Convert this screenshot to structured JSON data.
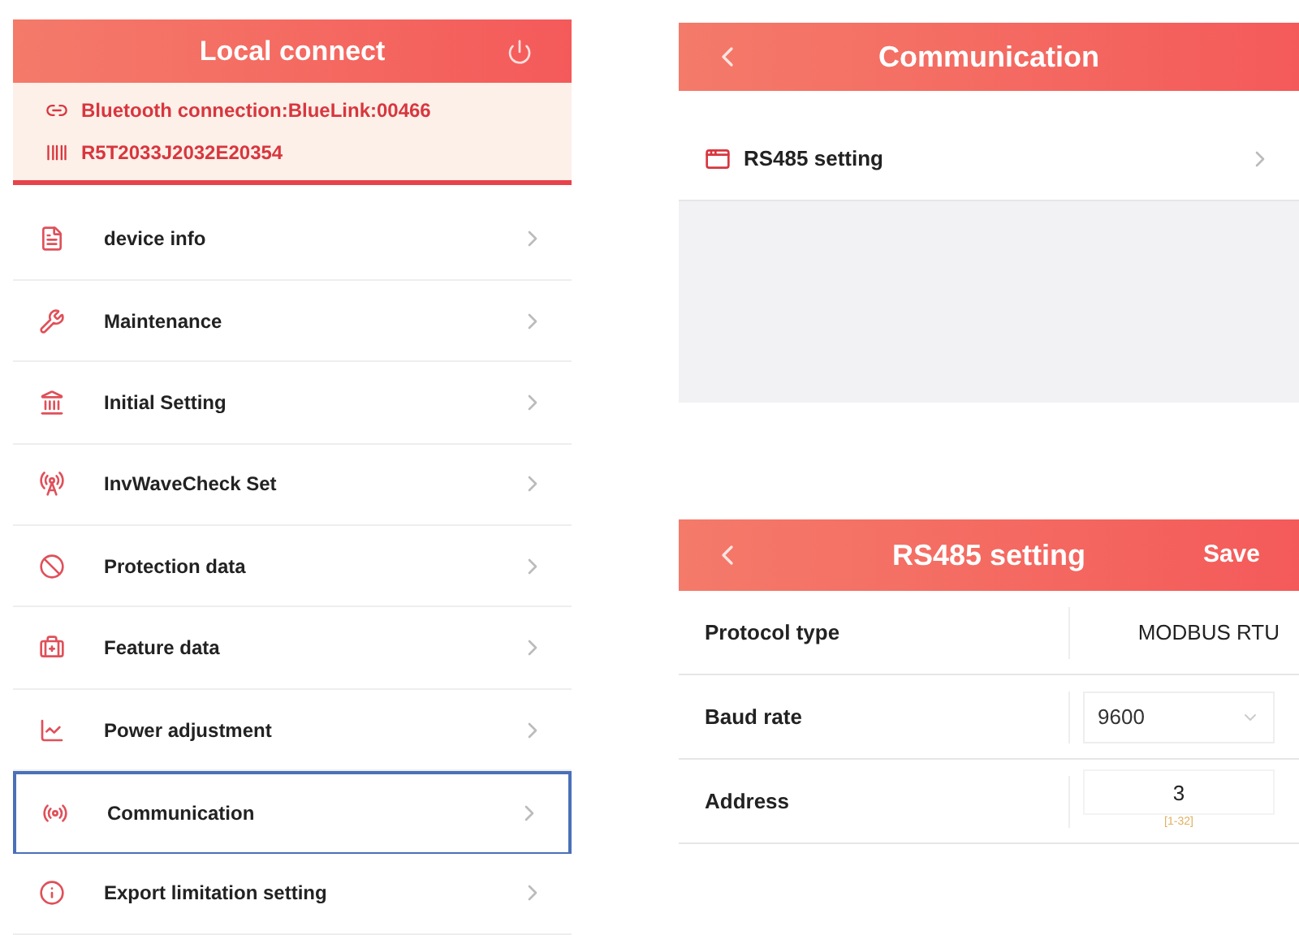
{
  "main_screen": {
    "title": "Local connect",
    "bluetooth": "Bluetooth connection:BlueLink:00466",
    "serial": "R5T2033J2032E20354",
    "menu": [
      {
        "label": "device info",
        "selected": false
      },
      {
        "label": "Maintenance",
        "selected": false
      },
      {
        "label": "Initial Setting",
        "selected": false
      },
      {
        "label": "InvWaveCheck Set",
        "selected": false
      },
      {
        "label": "Protection data",
        "selected": false
      },
      {
        "label": "Feature data",
        "selected": false
      },
      {
        "label": "Power adjustment",
        "selected": false
      },
      {
        "label": "Communication",
        "selected": true
      },
      {
        "label": "Export limitation setting",
        "selected": false
      }
    ]
  },
  "communication_screen": {
    "title": "Communication",
    "items": [
      {
        "label": "RS485 setting"
      }
    ]
  },
  "rs485_screen": {
    "title": "RS485 setting",
    "save": "Save",
    "fields": [
      {
        "kind": "text",
        "label": "Protocol type",
        "value": "MODBUS RTU"
      },
      {
        "kind": "select",
        "label": "Baud rate",
        "value": "9600"
      },
      {
        "kind": "input",
        "label": "Address",
        "value": "3",
        "hint": "[1-32]"
      }
    ]
  }
}
